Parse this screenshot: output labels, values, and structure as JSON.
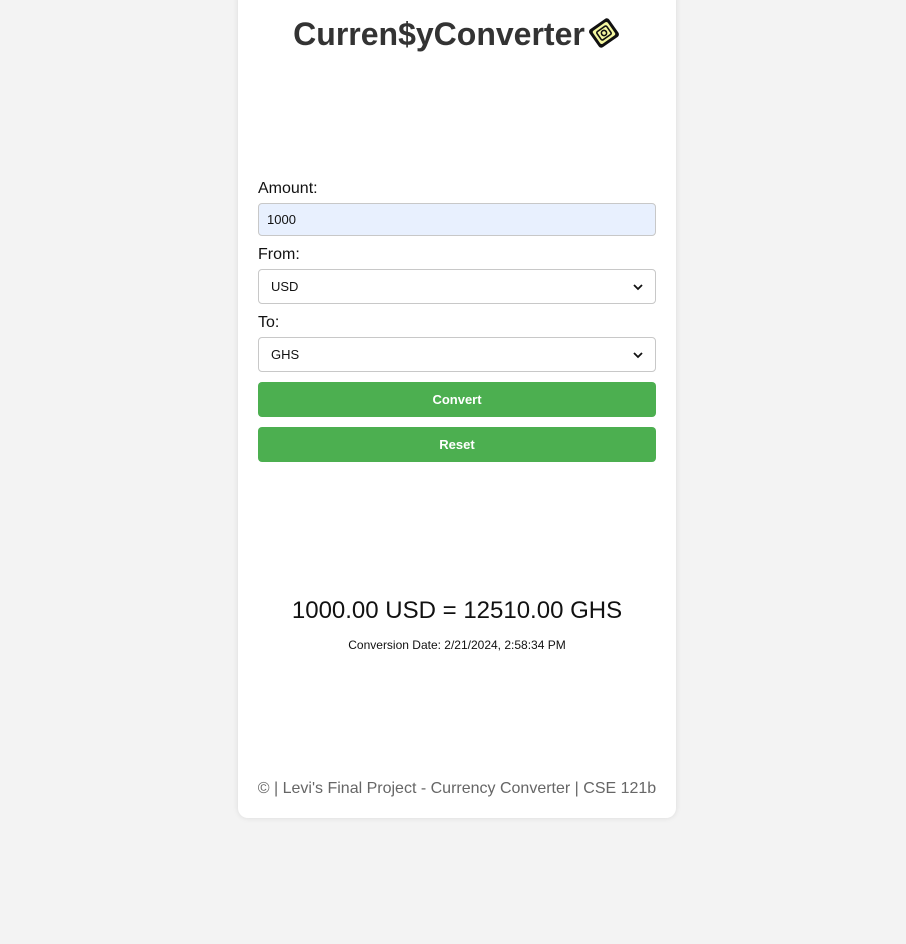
{
  "header": {
    "title": "Curren$yConverter",
    "logo_icon": "currency-note-icon"
  },
  "form": {
    "amount_label": "Amount:",
    "amount_value": "1000",
    "from_label": "From:",
    "from_value": "USD",
    "to_label": "To:",
    "to_value": "GHS",
    "convert_label": "Convert",
    "reset_label": "Reset"
  },
  "result": {
    "text": "1000.00 USD = 12510.00 GHS",
    "date_text": "Conversion Date: 2/21/2024, 2:58:34 PM"
  },
  "footer": {
    "text": "© | Levi's Final Project - Currency Converter | CSE 121b"
  },
  "colors": {
    "accent": "#4caf50",
    "background": "#f3f3f3",
    "card": "#ffffff",
    "input_autofill": "#e8f0fe"
  }
}
